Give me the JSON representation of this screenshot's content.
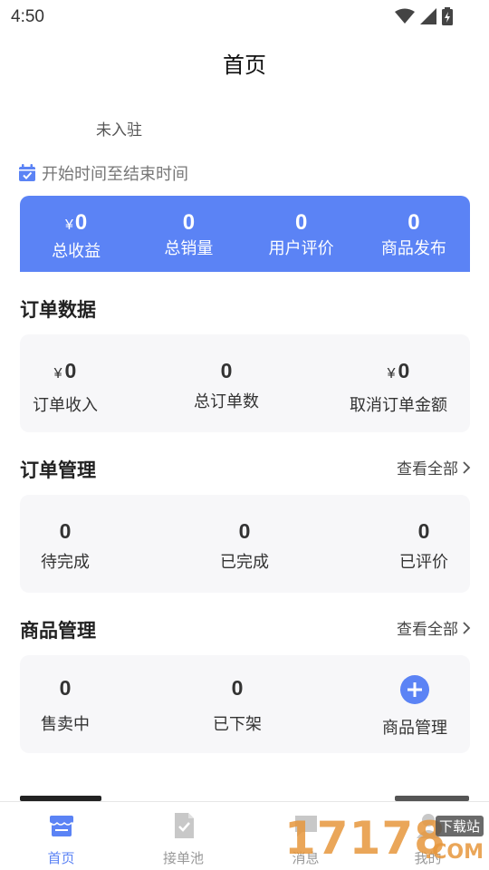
{
  "status_bar": {
    "time": "4:50"
  },
  "header": {
    "title": "首页"
  },
  "store": {
    "status": "未入驻"
  },
  "date_filter": {
    "placeholder": "开始时间至结束时间"
  },
  "overview": {
    "currency": "¥",
    "items": [
      {
        "value": "0",
        "label": "总收益"
      },
      {
        "value": "0",
        "label": "总销量"
      },
      {
        "value": "0",
        "label": "用户评价"
      },
      {
        "value": "0",
        "label": "商品发布"
      }
    ]
  },
  "order_data": {
    "title": "订单数据",
    "items": [
      {
        "currency": "¥",
        "value": "0",
        "label": "订单收入"
      },
      {
        "value": "0",
        "label": "总订单数"
      },
      {
        "currency": "¥",
        "value": "0",
        "label": "取消订单金额"
      }
    ]
  },
  "order_mgmt": {
    "title": "订单管理",
    "view_all": "查看全部",
    "items": [
      {
        "value": "0",
        "label": "待完成"
      },
      {
        "value": "0",
        "label": "已完成"
      },
      {
        "value": "0",
        "label": "已评价"
      }
    ]
  },
  "product_mgmt": {
    "title": "商品管理",
    "view_all": "查看全部",
    "items": [
      {
        "value": "0",
        "label": "售卖中"
      },
      {
        "value": "0",
        "label": "已下架"
      },
      {
        "label": "商品管理"
      }
    ]
  },
  "tabs": [
    {
      "label": "首页",
      "active": true
    },
    {
      "label": "接单池"
    },
    {
      "label": "消息"
    },
    {
      "label": "我的"
    }
  ],
  "watermark": {
    "text": "17178",
    "badge": "下载站",
    "suffix": ".COM"
  },
  "colors": {
    "accent": "#5b83f5",
    "panel_bg": "#f7f7f9"
  }
}
